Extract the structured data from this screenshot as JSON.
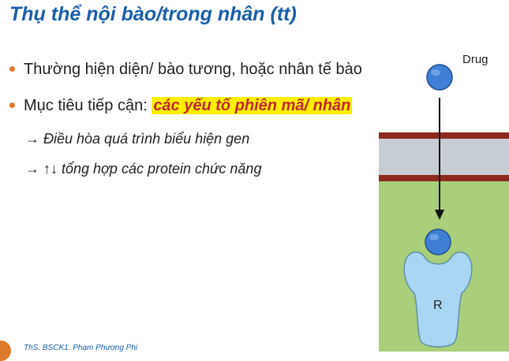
{
  "slide": {
    "title": "Thụ thể nội bào/trong nhân (tt)",
    "bullet1": "Thường hiện diện/ bào tương, hoặc nhân tế bào",
    "bullet2_prefix": "Mục tiêu tiếp cận: ",
    "bullet2_highlight": "các yếu tố phiên mã/ nhân",
    "sub1": "→ Điều hòa quá trình biểu hiện gen",
    "sub2": "→ ↑↓ tổng hợp các protein chức năng",
    "footer": "ThS. BSCK1. Phạm Phương Phi"
  },
  "figure": {
    "drug_label": "Drug",
    "receptor_label": "R",
    "colors": {
      "membrane_band": "#c6cdd3",
      "membrane_line": "#8e2a1d",
      "cytoplasm": "#a9cf7a",
      "drug": "#3f7fd6",
      "receptor": "#a9d6f2"
    }
  }
}
